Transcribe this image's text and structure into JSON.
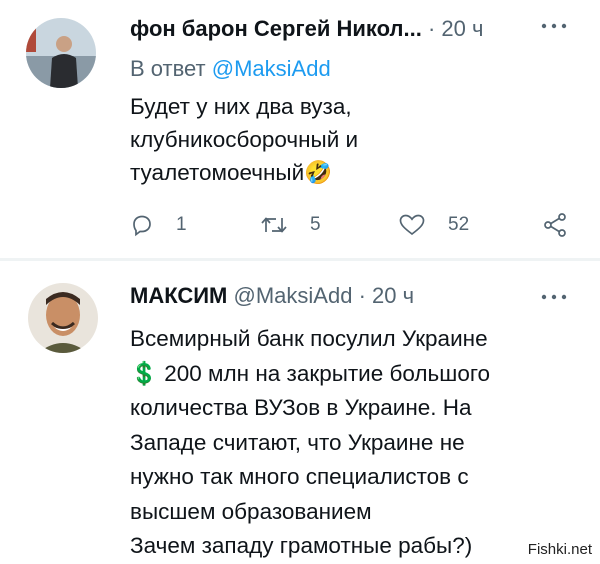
{
  "tweets": [
    {
      "author": "фон барон Сергей Никол...",
      "dot": "·",
      "time": "20 ч",
      "reply_prefix": "В ответ",
      "reply_mention": "@MaksiAdd",
      "text_lines": [
        "Будет у них два вуза,",
        "клубникосборочный и",
        "туалетомоечный"
      ],
      "text_emoji": "🤣",
      "actions": {
        "replies": "1",
        "retweets": "5",
        "likes": "52"
      },
      "avatar_icon": "avatar-man-standing"
    },
    {
      "author": "МАКСИМ",
      "handle": "@MaksiAdd",
      "dot": "·",
      "time": "20 ч",
      "text_lines": [
        "Всемирный банк посулил Украине",
        "💲 200 млн на закрытие большого",
        "количества ВУЗов в Украине. На",
        "Западе считают, что Украине не",
        "нужно так много специалистов с",
        "высшем образованием",
        "Зачем западу грамотные рабы?)"
      ],
      "avatar_icon": "avatar-smiling-man"
    }
  ],
  "watermark": "Fishki.net",
  "colors": {
    "text": "#0f1419",
    "secondary": "#536471",
    "link": "#1d9bf0",
    "divider": "#eff3f4"
  }
}
